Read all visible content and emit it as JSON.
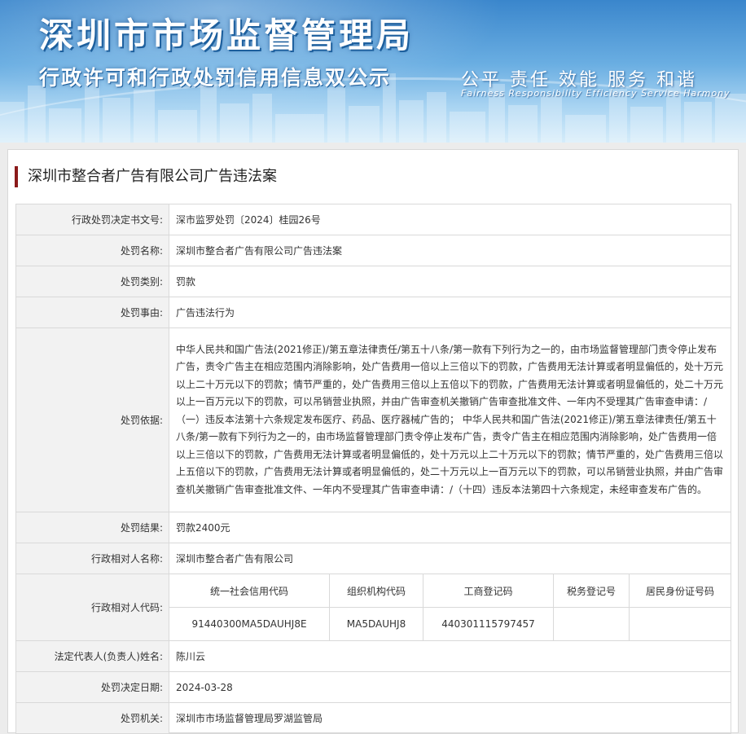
{
  "banner": {
    "title": "深圳市市场监督管理局",
    "subtitle": "行政许可和行政处罚信用信息双公示",
    "slogan": "公平  责任  效能  服务  和谐",
    "slogan_en": "Fairness  Responsibility  Efficiency  Service  Harmony"
  },
  "case_title": "深圳市整合者广告有限公司广告违法案",
  "fields": {
    "decision_no": {
      "label": "行政处罚决定书文号:",
      "value": "深市监罗处罚〔2024〕桂园26号"
    },
    "penalty_name": {
      "label": "处罚名称:",
      "value": "深圳市整合者广告有限公司广告违法案"
    },
    "penalty_type": {
      "label": "处罚类别:",
      "value": "罚款"
    },
    "penalty_reason": {
      "label": "处罚事由:",
      "value": "广告违法行为"
    },
    "penalty_basis": {
      "label": "处罚依据:",
      "value": "中华人民共和国广告法(2021修正)/第五章法律责任/第五十八条/第一款有下列行为之一的，由市场监督管理部门责令停止发布广告，责令广告主在相应范围内消除影响，处广告费用一倍以上三倍以下的罚款，广告费用无法计算或者明显偏低的，处十万元以上二十万元以下的罚款；情节严重的，处广告费用三倍以上五倍以下的罚款，广告费用无法计算或者明显偏低的，处二十万元以上一百万元以下的罚款，可以吊销营业执照，并由广告审查机关撤销广告审查批准文件、一年内不受理其广告审查申请：/（一）违反本法第十六条规定发布医疗、药品、医疗器械广告的； 中华人民共和国广告法(2021修正)/第五章法律责任/第五十八条/第一款有下列行为之一的，由市场监督管理部门责令停止发布广告，责令广告主在相应范围内消除影响，处广告费用一倍以上三倍以下的罚款，广告费用无法计算或者明显偏低的，处十万元以上二十万元以下的罚款；情节严重的，处广告费用三倍以上五倍以下的罚款，广告费用无法计算或者明显偏低的，处二十万元以上一百万元以下的罚款，可以吊销营业执照，并由广告审查机关撤销广告审查批准文件、一年内不受理其广告审查申请：/（十四）违反本法第四十六条规定，未经审查发布广告的。"
    },
    "penalty_result": {
      "label": "处罚结果:",
      "value": "罚款2400元"
    },
    "counterparty_name": {
      "label": "行政相对人名称:",
      "value": "深圳市整合者广告有限公司"
    },
    "counterparty_code": {
      "label": "行政相对人代码:",
      "headers": [
        "统一社会信用代码",
        "组织机构代码",
        "工商登记码",
        "税务登记号",
        "居民身份证号码"
      ],
      "values": [
        "91440300MA5DAUHJ8E",
        "MA5DAUHJ8",
        "440301115797457",
        "",
        ""
      ]
    },
    "legal_rep": {
      "label": "法定代表人(负责人)姓名:",
      "value": "陈川云"
    },
    "decision_date": {
      "label": "处罚决定日期:",
      "value": "2024-03-28"
    },
    "authority": {
      "label": "处罚机关:",
      "value": "深圳市市场监督管理局罗湖监管局"
    }
  }
}
